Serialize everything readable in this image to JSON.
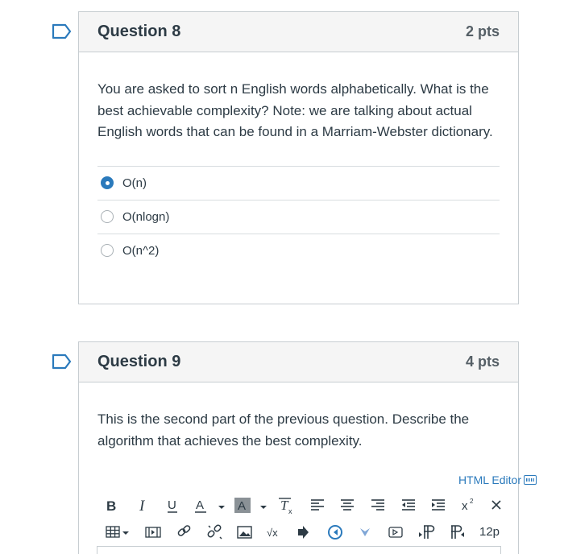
{
  "question8": {
    "title": "Question 8",
    "points": "2 pts",
    "text": "You are asked to sort n English words alphabetically.  What is the best achievable complexity? Note: we are talking about actual English words that can be found in a Marriam-Webster dictionary.",
    "answers": [
      {
        "label": "O(n)",
        "selected": true
      },
      {
        "label": "O(nlogn)",
        "selected": false
      },
      {
        "label": "O(n^2)",
        "selected": false
      }
    ]
  },
  "question9": {
    "title": "Question 9",
    "points": "4 pts",
    "text": "This is the second part of the previous question. Describe the algorithm that achieves the best complexity.",
    "html_editor_label": "HTML Editor",
    "toolbar": {
      "font_size": "12p",
      "row1_icons": [
        "bold-icon",
        "italic-icon",
        "underline-icon",
        "font-color-icon",
        "background-color-icon",
        "clear-formatting-icon",
        "align-left-icon",
        "align-center-icon",
        "align-right-icon",
        "outdent-icon",
        "indent-icon",
        "superscript-icon",
        "subscript-icon"
      ],
      "row2_icons": [
        "table-icon",
        "media-icon",
        "link-icon",
        "unlink-icon",
        "image-icon",
        "math-icon",
        "embed-icon",
        "apps-icon",
        "more-apps-icon",
        "record-media-icon",
        "ltr-icon",
        "rtl-icon"
      ]
    }
  },
  "colors": {
    "accent": "#2b7abc",
    "text": "#2d3b45",
    "border": "#c7cdd1",
    "header_bg": "#f5f5f5"
  }
}
